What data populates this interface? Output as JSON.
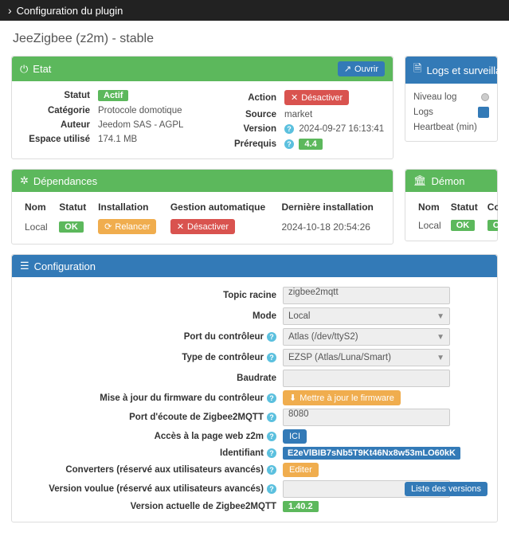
{
  "topbar": {
    "title": "Configuration du plugin"
  },
  "header": {
    "title": "JeeZigbee (z2m) - stable"
  },
  "etat": {
    "title": "Etat",
    "open_btn": "Ouvrir",
    "left": {
      "statut_lbl": "Statut",
      "statut_val": "Actif",
      "categorie_lbl": "Catégorie",
      "categorie_val": "Protocole domotique",
      "auteur_lbl": "Auteur",
      "auteur_val": "Jeedom SAS - AGPL",
      "espace_lbl": "Espace utilisé",
      "espace_val": "174.1 MB"
    },
    "right": {
      "action_lbl": "Action",
      "action_btn": "Désactiver",
      "source_lbl": "Source",
      "source_val": "market",
      "version_lbl": "Version",
      "version_val": "2024-09-27 16:13:41",
      "prerequis_lbl": "Prérequis",
      "prerequis_val": "4.4"
    }
  },
  "logs": {
    "title": "Logs et surveillance",
    "niveau_lbl": "Niveau log",
    "logs_lbl": "Logs",
    "heartbeat_lbl": "Heartbeat (min)"
  },
  "deps": {
    "title": "Dépendances",
    "headers": {
      "nom": "Nom",
      "statut": "Statut",
      "install": "Installation",
      "auto": "Gestion automatique",
      "last": "Dernière installation"
    },
    "row": {
      "nom": "Local",
      "statut": "OK",
      "install": "Relancer",
      "auto": "Désactiver",
      "last": "2024-10-18 20:54:26"
    }
  },
  "demon": {
    "title": "Démon",
    "headers": {
      "nom": "Nom",
      "statut": "Statut",
      "config": "Configuration"
    },
    "row": {
      "nom": "Local",
      "statut": "OK",
      "config": "OK"
    }
  },
  "config": {
    "title": "Configuration",
    "topic_lbl": "Topic racine",
    "topic_val": "zigbee2mqtt",
    "mode_lbl": "Mode",
    "mode_val": "Local",
    "port_ctrl_lbl": "Port du contrôleur",
    "port_ctrl_val": "Atlas (/dev/ttyS2)",
    "type_ctrl_lbl": "Type de contrôleur",
    "type_ctrl_val": "EZSP (Atlas/Luna/Smart)",
    "baud_lbl": "Baudrate",
    "baud_val": "",
    "fw_lbl": "Mise à jour du firmware du contrôleur",
    "fw_btn": "Mettre à jour le firmware",
    "port_z2m_lbl": "Port d'écoute de Zigbee2MQTT",
    "port_z2m_val": "8080",
    "web_lbl": "Accès à la page web z2m",
    "web_btn": "ICI",
    "id_lbl": "Identifiant",
    "id_val": "E2eVlBIB7sNb5T9Kt46Nx8w53mLO60kK",
    "conv_lbl": "Converters (réservé aux utilisateurs avancés)",
    "conv_btn": "Editer",
    "ver_want_lbl": "Version voulue (réservé aux utilisateurs avancés)",
    "ver_want_val": "",
    "ver_cur_lbl": "Version actuelle de Zigbee2MQTT",
    "ver_cur_val": "1.40.2",
    "versions_btn": "Liste des versions"
  }
}
